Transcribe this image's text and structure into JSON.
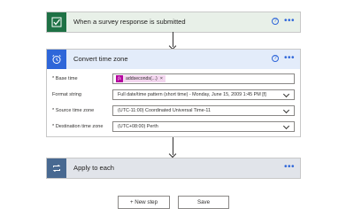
{
  "trigger": {
    "title": "When a survey response is submitted",
    "help": "?",
    "more": "•••",
    "color": "#1e7145",
    "header_bg": "#e8f0e8"
  },
  "convert": {
    "title": "Convert time zone",
    "help": "?",
    "more": "•••",
    "color": "#2e66d9",
    "header_bg": "#e3ecfa",
    "fields": {
      "base_time": {
        "label": "* Base time",
        "token_icon": "fx",
        "token_text": "addseconds(...)",
        "token_remove": "×"
      },
      "format_string": {
        "label": "Format string",
        "value": "Full date/time pattern (short time) - Monday, June 15, 2009 1:45 PM [f]"
      },
      "source_tz": {
        "label": "* Source time zone",
        "value": "(UTC-11:00) Coordinated Universal Time-11"
      },
      "destination_tz": {
        "label": "* Destination time zone",
        "value": "(UTC+08:00) Perth"
      }
    }
  },
  "apply_each": {
    "title": "Apply to each",
    "more": "•••",
    "color": "#486991",
    "header_bg": "#e1e4ea"
  },
  "actions": {
    "new_step": "+ New step",
    "save": "Save"
  }
}
